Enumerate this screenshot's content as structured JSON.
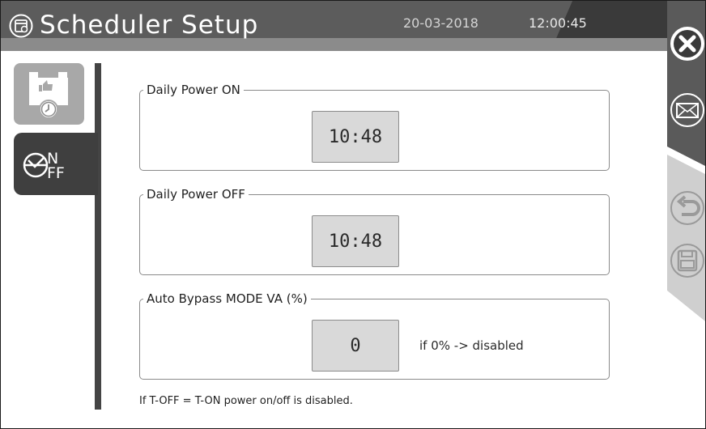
{
  "header": {
    "title": "Scheduler Setup",
    "date": "20-03-2018",
    "time": "12:00:45",
    "bg_color": "#8b8b8b"
  },
  "rightbar": {
    "buttons": [
      {
        "name": "close",
        "icon": "close-icon"
      },
      {
        "name": "message",
        "icon": "envelope-icon"
      },
      {
        "name": "undo",
        "icon": "undo-icon"
      },
      {
        "name": "save",
        "icon": "save-icon"
      }
    ]
  },
  "tabs": [
    {
      "name": "battery-schedule",
      "icon": "battery-clock-icon",
      "active": false
    },
    {
      "name": "on-off",
      "icon": "on-off-gauge-icon",
      "label_on": "N",
      "label_off": "FF",
      "active": true
    }
  ],
  "groups": {
    "power_on": {
      "label": "Daily Power ON",
      "value": "10:48"
    },
    "power_off": {
      "label": "Daily Power OFF",
      "value": "10:48"
    },
    "bypass": {
      "label": "Auto Bypass MODE VA (%)",
      "value": "0",
      "hint": "if 0% -> disabled"
    }
  },
  "note": "If T-OFF = T-ON power on/off is disabled."
}
